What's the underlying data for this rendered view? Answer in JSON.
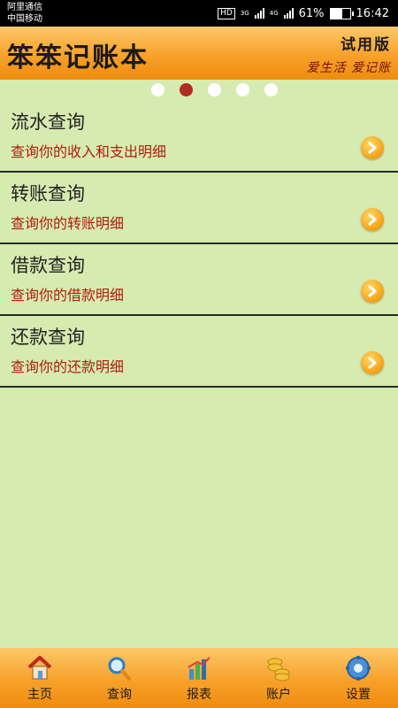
{
  "status_bar": {
    "carrier1": "阿里通信",
    "carrier2": "中国移动",
    "hd": "HD",
    "net1": "3G",
    "net2": "4G",
    "battery": "61%",
    "time": "16:42"
  },
  "header": {
    "app_title": "笨笨记账本",
    "trial": "试用版",
    "slogan": "爱生活  爱记账"
  },
  "pager": {
    "count": 5,
    "active_index": 1
  },
  "queries": [
    {
      "title": "流水查询",
      "desc": "查询你的收入和支出明细"
    },
    {
      "title": "转账查询",
      "desc": "查询你的转账明细"
    },
    {
      "title": "借款查询",
      "desc": "查询你的借款明细"
    },
    {
      "title": "还款查询",
      "desc": "查询你的还款明细"
    }
  ],
  "nav": {
    "home": "主页",
    "query": "查询",
    "report": "报表",
    "account": "账户",
    "settings": "设置"
  },
  "colors": {
    "accent": "#f7a12a",
    "background": "#d6ebb0",
    "desc_text": "#b01c12",
    "active_dot": "#b22a22"
  }
}
